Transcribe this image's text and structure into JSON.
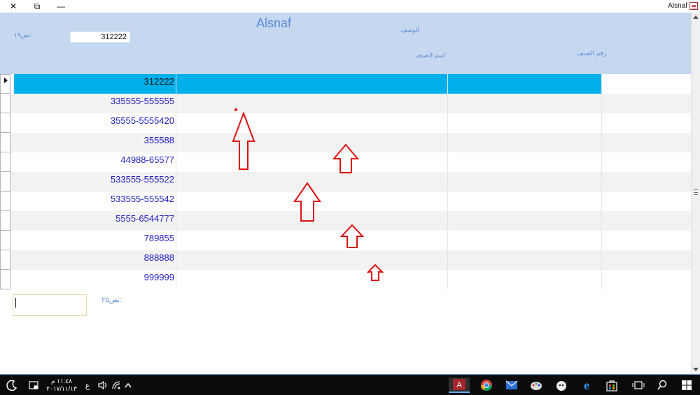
{
  "window": {
    "title": "Alsnaf",
    "close_glyph": "✕",
    "restore_glyph": "⧉",
    "minimize_glyph": "—"
  },
  "header": {
    "heading": "Alsnaf",
    "search_label": "نص١٩:",
    "search_value": "312222",
    "col_desc_label": "الوصف",
    "col_name_label": "اسم الصنف",
    "col_code_label": "رقم الصنف"
  },
  "records": [
    "312222",
    "335555-555555",
    "35555-5555420",
    "355588",
    "44988-65577",
    "533555-555522",
    "533555-555542",
    "5555-6544777",
    "789855",
    "888888",
    "999999"
  ],
  "footer": {
    "field_label": "نص٢٥:",
    "field_value": ""
  },
  "taskbar": {
    "time": "١١:٤٨ م",
    "date": "٢٠١٧/١١/١٣",
    "lang": "ع",
    "icons": [
      "moon-icon",
      "notification-icon",
      "volume-icon",
      "wifi-icon",
      "chevron-up-icon",
      "access-icon",
      "chrome-icon",
      "mail-icon",
      "paint-icon",
      "sheep-icon",
      "edge-icon",
      "store-icon",
      "task-view-icon",
      "search-icon",
      "start-icon"
    ]
  },
  "colors": {
    "header_bg": "#c6d7f0",
    "selected_row": "#00b0ea",
    "text_blue": "#2020c0",
    "arrow_red": "#e01010"
  }
}
